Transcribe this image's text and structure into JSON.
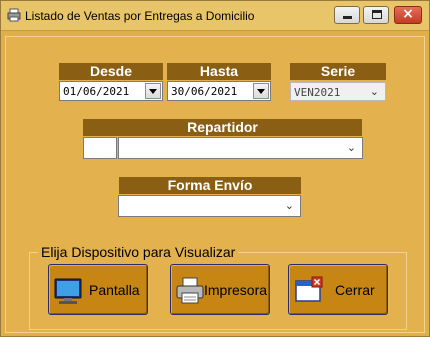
{
  "window": {
    "title": "Listado de Ventas por Entregas a Domicilio"
  },
  "filters": {
    "desde": {
      "label": "Desde",
      "value": "01/06/2021"
    },
    "hasta": {
      "label": "Hasta",
      "value": "30/06/2021"
    },
    "serie": {
      "label": "Serie",
      "value": "VEN2021"
    },
    "repartidor": {
      "label": "Repartidor",
      "code": "",
      "value": ""
    },
    "forma_envio": {
      "label": "Forma Envío",
      "value": ""
    }
  },
  "output": {
    "group_label": "Elija Dispositivo para Visualizar",
    "pantalla": {
      "label": "Pantalla",
      "icon": "monitor-icon"
    },
    "impresora": {
      "label": "Impresora",
      "icon": "printer-icon"
    },
    "cerrar": {
      "label": "Cerrar",
      "icon": "close-window-icon"
    }
  },
  "colors": {
    "background": "#e3b24e",
    "header": "#8b5f13",
    "button": "#c78614"
  }
}
